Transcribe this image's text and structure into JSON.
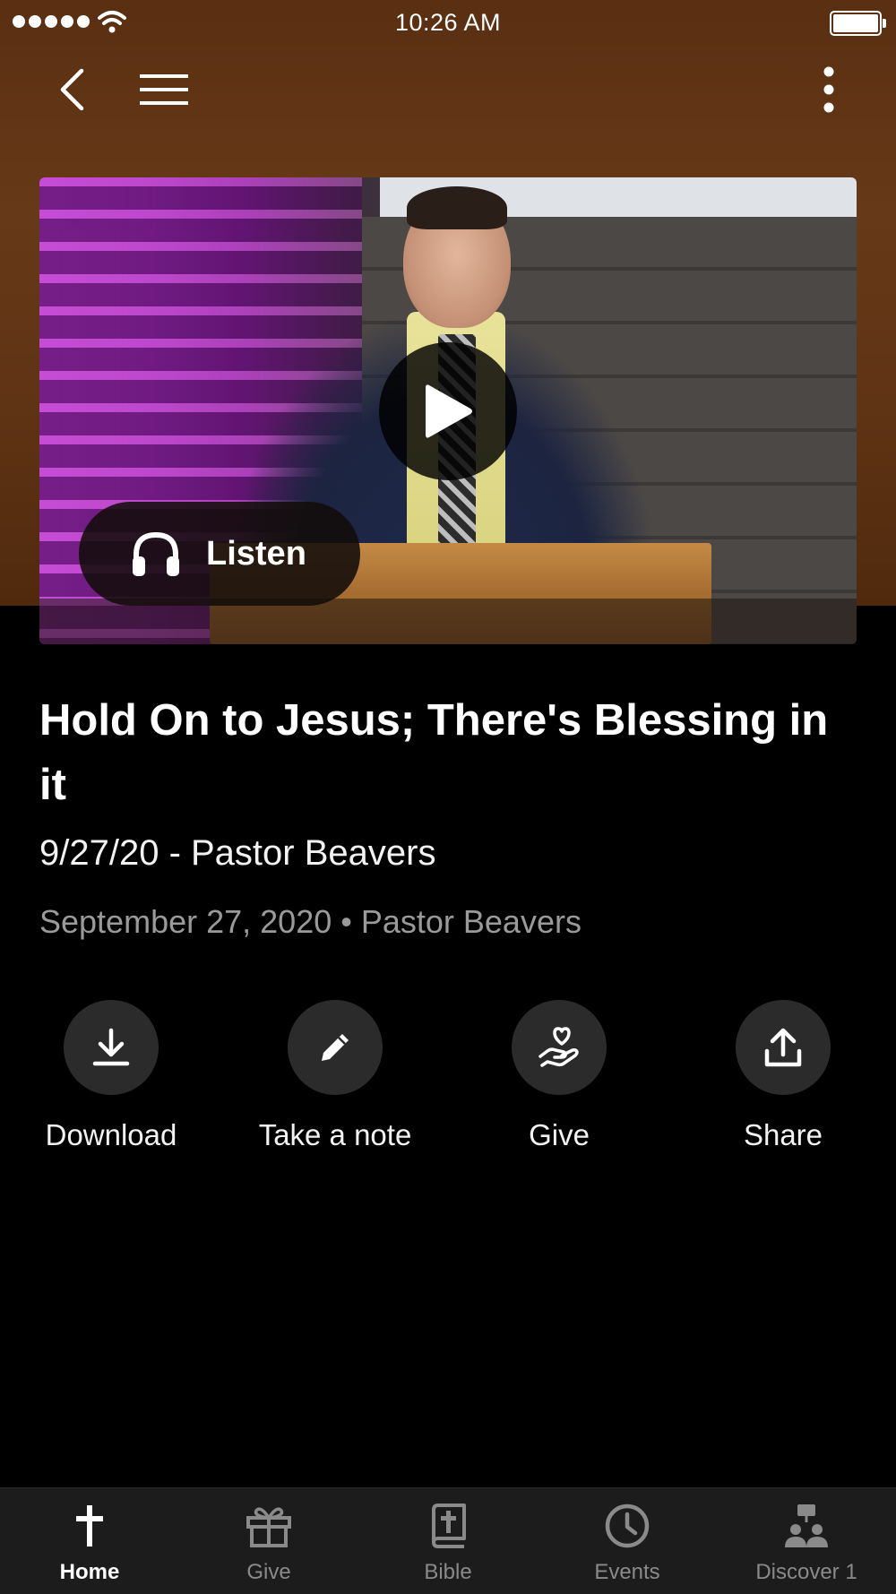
{
  "status_bar": {
    "time": "10:26 AM"
  },
  "nav": {
    "back_icon": "chevron-left-icon",
    "menu_icon": "hamburger-icon",
    "more_icon": "more-vertical-icon"
  },
  "media": {
    "play_icon": "play-icon",
    "listen_label": "Listen",
    "listen_icon": "headphones-icon"
  },
  "sermon": {
    "title": "Hold On to Jesus; There's Blessing in it",
    "subtitle": "9/27/20 - Pastor Beavers",
    "date": "September 27, 2020",
    "separator": "•",
    "speaker": "Pastor Beavers"
  },
  "actions": [
    {
      "label": "Download",
      "icon": "download-icon"
    },
    {
      "label": "Take a note",
      "icon": "pencil-icon"
    },
    {
      "label": "Give",
      "icon": "hand-heart-icon"
    },
    {
      "label": "Share",
      "icon": "share-icon"
    }
  ],
  "tabs": [
    {
      "label": "Home",
      "icon": "cross-icon",
      "active": true
    },
    {
      "label": "Give",
      "icon": "gift-icon",
      "active": false
    },
    {
      "label": "Bible",
      "icon": "bible-icon",
      "active": false
    },
    {
      "label": "Events",
      "icon": "clock-icon",
      "active": false
    },
    {
      "label": "Discover 1",
      "icon": "discover-people-icon",
      "active": false
    }
  ],
  "colors": {
    "header_brown": "#5e3314",
    "background": "#000000",
    "action_circle": "#2b2b2b",
    "tab_bar": "#1c1c1c",
    "inactive_tab": "#8a8a8a"
  }
}
